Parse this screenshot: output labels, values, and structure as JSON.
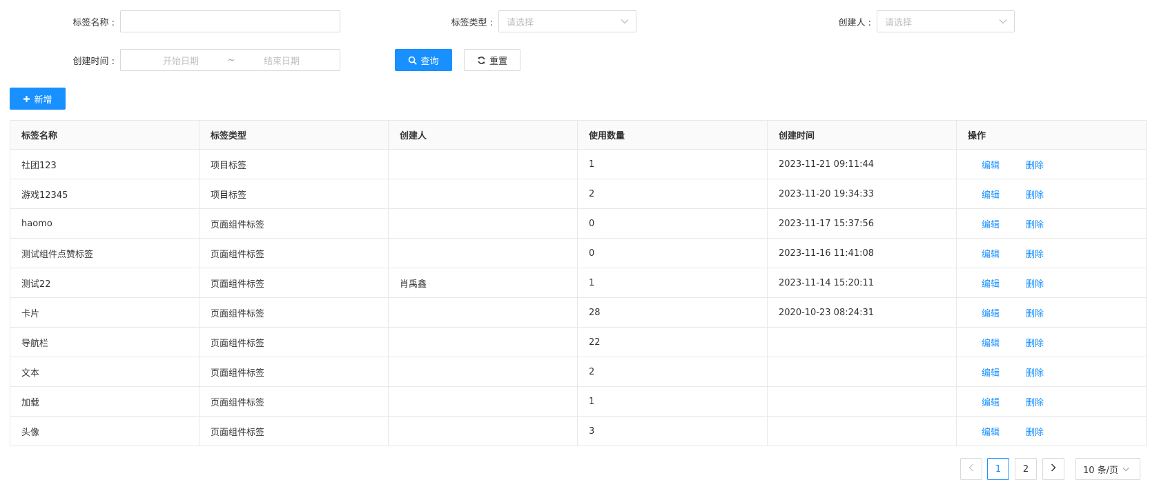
{
  "filters": {
    "tag_name": {
      "label": "标签名称 :",
      "value": "",
      "placeholder": ""
    },
    "tag_type": {
      "label": "标签类型 :",
      "placeholder": "请选择"
    },
    "creator": {
      "label": "创建人 :",
      "placeholder": "请选择"
    },
    "create_time": {
      "label": "创建时间 :",
      "start_placeholder": "开始日期",
      "separator": "~",
      "end_placeholder": "结束日期"
    }
  },
  "buttons": {
    "query": "查询",
    "reset": "重置",
    "add": "新增"
  },
  "table": {
    "headers": [
      "标签名称",
      "标签类型",
      "创建人",
      "使用数量",
      "创建时间",
      "操作"
    ],
    "rows": [
      {
        "name": "社团123",
        "type": "项目标签",
        "creator": "",
        "count": "1",
        "time": "2023-11-21 09:11:44"
      },
      {
        "name": "游戏12345",
        "type": "项目标签",
        "creator": "",
        "count": "2",
        "time": "2023-11-20 19:34:33"
      },
      {
        "name": "haomo",
        "type": "页面组件标签",
        "creator": "",
        "count": "0",
        "time": "2023-11-17 15:37:56"
      },
      {
        "name": "测试组件点赞标签",
        "type": "页面组件标签",
        "creator": "",
        "count": "0",
        "time": "2023-11-16 11:41:08"
      },
      {
        "name": "测试22",
        "type": "页面组件标签",
        "creator": "肖禹鑫",
        "count": "1",
        "time": "2023-11-14 15:20:11"
      },
      {
        "name": "卡片",
        "type": "页面组件标签",
        "creator": "",
        "count": "28",
        "time": "2020-10-23 08:24:31"
      },
      {
        "name": "导航栏",
        "type": "页面组件标签",
        "creator": "",
        "count": "22",
        "time": ""
      },
      {
        "name": "文本",
        "type": "页面组件标签",
        "creator": "",
        "count": "2",
        "time": ""
      },
      {
        "name": "加载",
        "type": "页面组件标签",
        "creator": "",
        "count": "1",
        "time": ""
      },
      {
        "name": "头像",
        "type": "页面组件标签",
        "creator": "",
        "count": "3",
        "time": ""
      }
    ],
    "actions": {
      "edit": "编辑",
      "delete": "删除"
    }
  },
  "pagination": {
    "pages": [
      "1",
      "2"
    ],
    "current": "1",
    "page_size": "10 条/页"
  },
  "colors": {
    "primary": "#1890ff",
    "border": "#d9d9d9",
    "header_bg": "#fafafa",
    "placeholder": "#bfbfbf"
  }
}
